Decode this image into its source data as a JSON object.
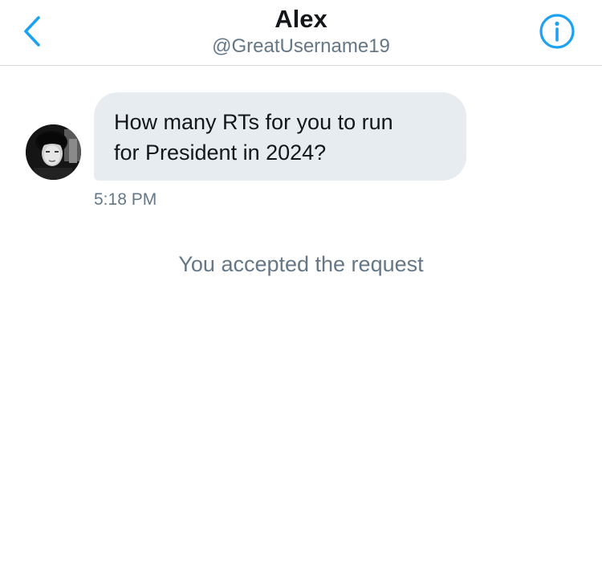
{
  "header": {
    "back_icon": "chevron-left-icon",
    "title": "Alex",
    "subtitle": "@GreatUsername19",
    "info_icon": "info-circle-icon",
    "accent_color": "#1da1f2"
  },
  "conversation": {
    "messages": [
      {
        "sender": "received",
        "avatar_icon": "user-avatar",
        "text_line_1": "How many RTs for you to run",
        "text_line_2": "for President in 2024?",
        "time": "5:18 PM"
      }
    ],
    "system_note": "You accepted the request"
  },
  "colors": {
    "bubble_bg": "#e6ecf0",
    "text_primary": "#14171a",
    "text_secondary": "#657786",
    "divider": "#d6dadd"
  }
}
